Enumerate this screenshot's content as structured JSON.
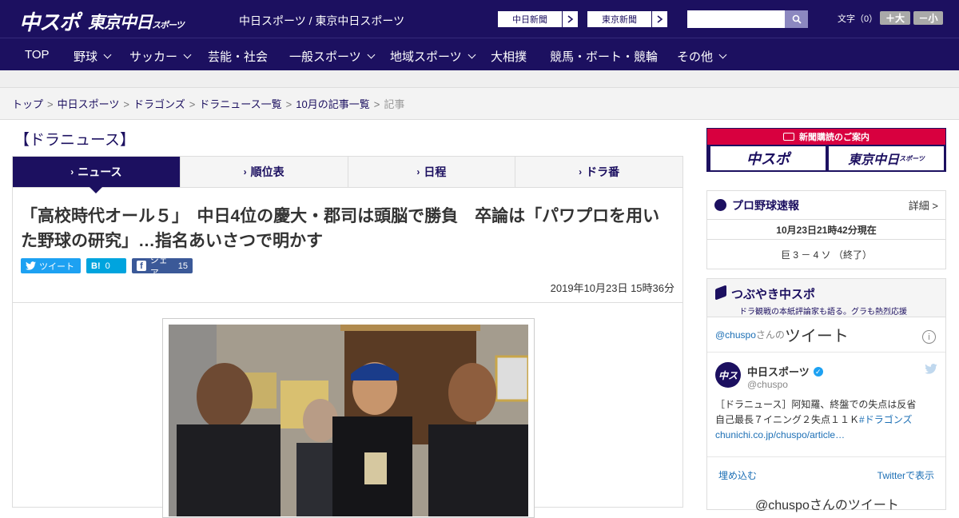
{
  "header": {
    "logo_chuspo": "中スポ",
    "logo_tokyo": "東京中日",
    "logo_tokyo_sub": "スポーツ",
    "site_name": "中日スポーツ / 東京中日スポーツ",
    "ext_chunichi": "中日新聞",
    "ext_tokyo": "東京新聞",
    "search_placeholder": "",
    "font_label": "文字（0）",
    "font_bigger": "＋大",
    "font_smaller": "－小"
  },
  "nav": {
    "items": [
      {
        "label": "TOP"
      },
      {
        "label": "野球"
      },
      {
        "label": "サッカー"
      },
      {
        "label": "芸能・社会"
      },
      {
        "label": "一般スポーツ"
      },
      {
        "label": "地域スポーツ"
      },
      {
        "label": "大相撲"
      },
      {
        "label": "競馬・ボート・競輪"
      },
      {
        "label": "その他"
      }
    ]
  },
  "breadcrumb": {
    "items": [
      "トップ",
      "中日スポーツ",
      "ドラゴンズ",
      "ドラニュース一覧",
      "10月の記事一覧"
    ],
    "current": "記事",
    "separator": ">"
  },
  "section": {
    "title": "【ドラニュース】"
  },
  "tabs": [
    {
      "label": "ニュース"
    },
    {
      "label": "順位表"
    },
    {
      "label": "日程"
    },
    {
      "label": "ドラ番"
    }
  ],
  "article": {
    "headline": "「高校時代オール５」　中日4位の慶大・郡司は頭脳で勝負　卒論は「パワプロを用いた野球の研究」…指名あいさつで明かす",
    "tweet_label": "ツイート",
    "hatena_label": "B!",
    "hatena_count": "0",
    "share_label": "シェア",
    "share_count": "15",
    "date": "2019年10月23日 15時36分"
  },
  "sidebar": {
    "promo_title": "新聞購読のご案内",
    "promo_chuspo": "中スポ",
    "promo_tokyo": "東京中日",
    "promo_tokyo_sub": "スポーツ",
    "score_title": "プロ野球速報",
    "score_more": "詳細 >",
    "score_time": "10月23日21時42分現在",
    "score_line": "巨 3 － 4 ソ （終了）",
    "tw_title": "つぶやき中スポ",
    "tw_sub": "ドラ観戦の本紙評論家も語る。グラも熱烈応援",
    "tw_user": "@chuspo",
    "tw_san": "さんの",
    "tw_tweet": "ツイート",
    "tw_name": "中日スポーツ",
    "tw_handle": "@chuspo",
    "tw_text": "［ドラニュース］阿知羅、終盤での失点は反省　自己最長７イニング２失点１１Ｋ",
    "tw_link": "#ドラゴンズchunichi.co.jp/chuspo/article…",
    "tw_embed": "埋め込む",
    "tw_view": "Twitterで表示",
    "tw_more": "@chuspoさんのツイート"
  },
  "colors": {
    "brand_navy": "#1c1060",
    "twitter_blue": "#1da1f2",
    "hatena_blue": "#00a4de",
    "facebook_blue": "#3b5998",
    "promo_red": "#d8003f"
  }
}
